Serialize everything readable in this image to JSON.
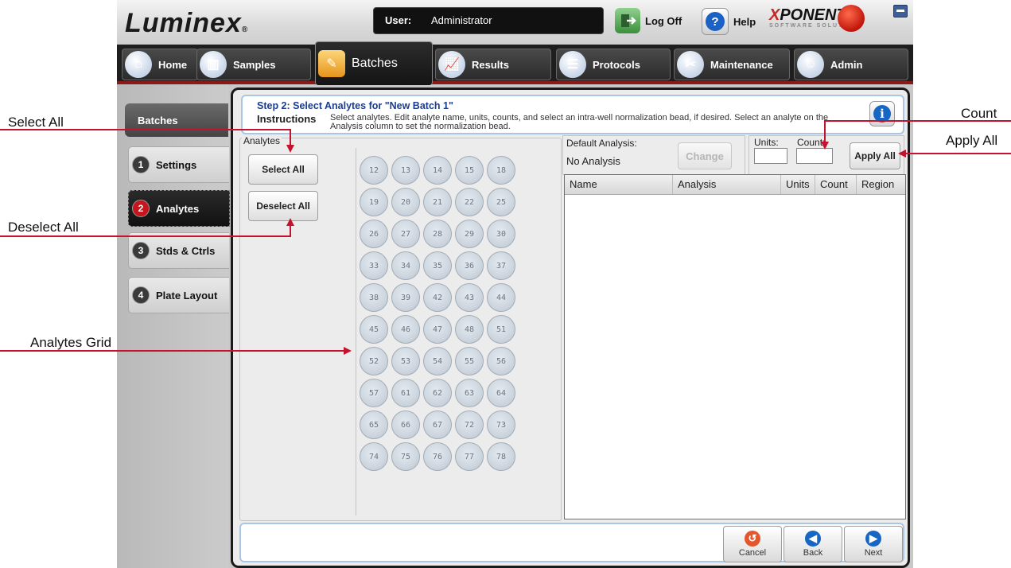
{
  "callouts": {
    "select_all": "Select All",
    "deselect_all": "Deselect All",
    "analytes_grid": "Analytes Grid",
    "count": "Count",
    "apply_all": "Apply All",
    "arrow_color": "#c4122f"
  },
  "header": {
    "logo": "Luminex",
    "logo_mark": "®",
    "user_label": "User:",
    "user_value": "Administrator",
    "logoff_label": "Log Off",
    "help_label": "Help",
    "brand": "XPONENT",
    "brand_sub": "SOFTWARE SOLUTIONS"
  },
  "nav": {
    "tabs": [
      {
        "label": "Home",
        "icon": "home-icon"
      },
      {
        "label": "Samples",
        "icon": "samples-icon"
      },
      {
        "label": "Batches",
        "icon": "batches-icon",
        "active": true
      },
      {
        "label": "Results",
        "icon": "results-icon"
      },
      {
        "label": "Protocols",
        "icon": "protocols-icon"
      },
      {
        "label": "Maintenance",
        "icon": "maintenance-icon"
      },
      {
        "label": "Admin",
        "icon": "admin-icon"
      }
    ]
  },
  "sidebar": {
    "header": "Batches",
    "steps": [
      {
        "num": "1",
        "label": "Settings"
      },
      {
        "num": "2",
        "label": "Analytes",
        "active": true
      },
      {
        "num": "3",
        "label": "Stds & Ctrls"
      },
      {
        "num": "4",
        "label": "Plate Layout"
      }
    ]
  },
  "instructions": {
    "title": "Step 2: Select Analytes for \"New Batch 1\"",
    "label": "Instructions",
    "text": "Select analytes. Edit analyte name, units, counts, and select an intra-well normalization bead, if desired. Select an analyte on the Analysis column to set the normalization bead."
  },
  "analytes": {
    "legend": "Analytes",
    "select_all": "Select All",
    "deselect_all": "Deselect All",
    "wells": [
      "12",
      "13",
      "14",
      "15",
      "18",
      "19",
      "20",
      "21",
      "22",
      "25",
      "26",
      "27",
      "28",
      "29",
      "30",
      "33",
      "34",
      "35",
      "36",
      "37",
      "38",
      "39",
      "42",
      "43",
      "44",
      "45",
      "46",
      "47",
      "48",
      "51",
      "52",
      "53",
      "54",
      "55",
      "56",
      "57",
      "61",
      "62",
      "63",
      "64",
      "65",
      "66",
      "67",
      "72",
      "73",
      "74",
      "75",
      "76",
      "77",
      "78"
    ]
  },
  "default_analysis": {
    "label": "Default Analysis:",
    "value": "No Analysis",
    "change": "Change"
  },
  "units_count": {
    "units_label": "Units:",
    "count_label": "Count:",
    "units_value": "",
    "count_value": "",
    "apply_all": "Apply All"
  },
  "table": {
    "columns": [
      "Name",
      "Analysis",
      "Units",
      "Count",
      "Region"
    ]
  },
  "footer": {
    "cancel": "Cancel",
    "back": "Back",
    "next": "Next"
  }
}
